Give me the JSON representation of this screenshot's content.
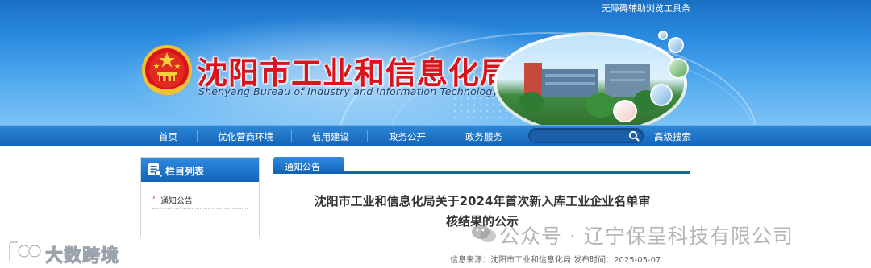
{
  "header": {
    "accessibility_link": "无障碍辅助浏览工具条",
    "site_title": "沈阳市工业和信息化局",
    "site_subtitle": "Shenyang Bureau of Industry and Information Technology",
    "emblem_icon": "national-emblem-icon"
  },
  "nav": {
    "items": [
      {
        "label": "首页"
      },
      {
        "label": "优化营商环境"
      },
      {
        "label": "信用建设"
      },
      {
        "label": "政务公开"
      },
      {
        "label": "政务服务"
      }
    ],
    "search": {
      "placeholder": "",
      "icon": "search-icon"
    },
    "advanced_search_label": "高级搜索"
  },
  "sidebar": {
    "heading": "栏目列表",
    "heading_icon": "column-list-icon",
    "items": [
      {
        "label": "通知公告"
      }
    ]
  },
  "main": {
    "section_tab": "通知公告",
    "article": {
      "title_line1": "沈阳市工业和信息化局关于2024年首次新入库工业企业名单审",
      "title_line2": "核结果的公示",
      "meta": "信息来源：沈阳市工业和信息化局 发布时间：2025-05-07"
    }
  },
  "watermarks": {
    "left_text": "大数跨境",
    "right_text": "公众号 · 辽宁保呈科技有限公司"
  },
  "colors": {
    "brand_blue": "#1563b7",
    "title_red": "#d8141c",
    "nav_text": "#ffffff"
  }
}
